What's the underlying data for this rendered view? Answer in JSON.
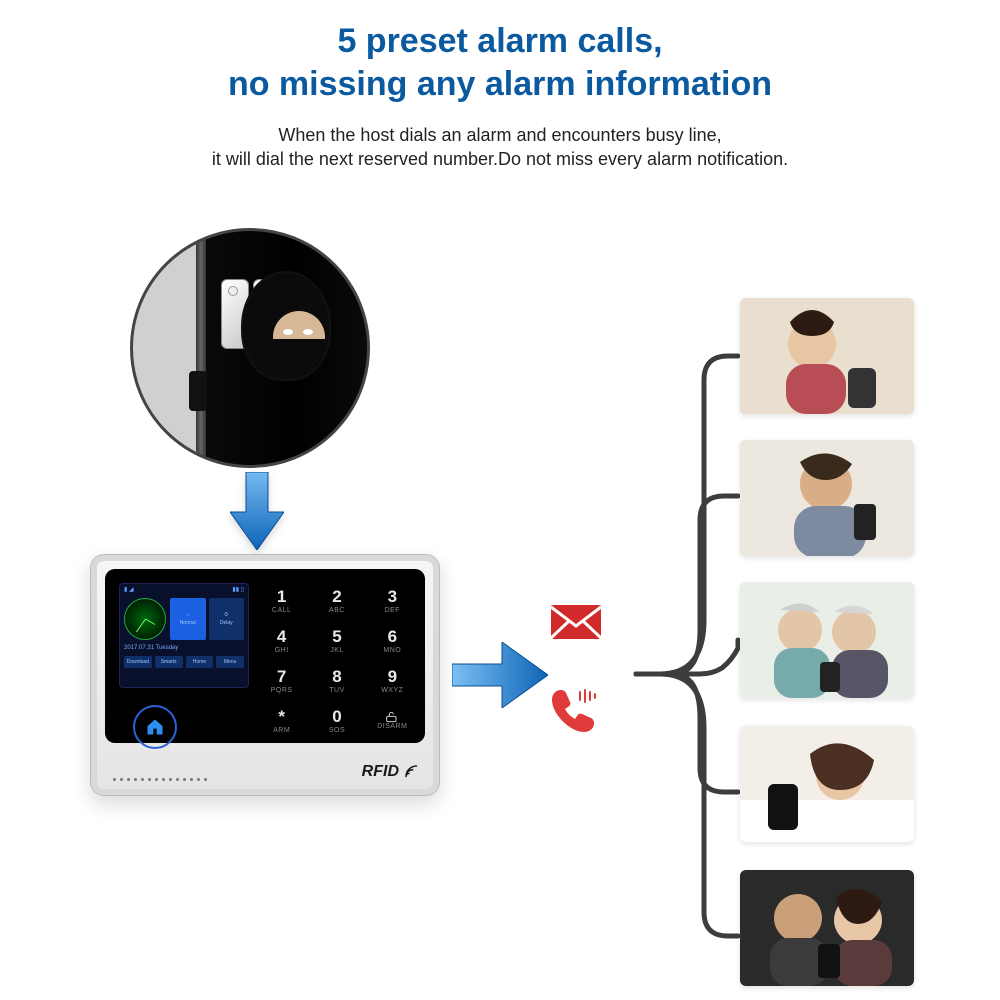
{
  "header": {
    "title_line1": "5 preset alarm calls,",
    "title_line2": "no missing any alarm information",
    "sub_line1": "When the host dials an alarm and encounters busy line,",
    "sub_line2": "it will dial the next reserved number.Do not miss every alarm notification."
  },
  "device": {
    "brand": "RFID",
    "lcd": {
      "date": "2017.07.31 Tuesday",
      "tiles": [
        "Normal",
        "Delay"
      ],
      "bottom": [
        "Download",
        "Smarts",
        "Home",
        "Menu"
      ]
    },
    "keypad": [
      {
        "n": "1",
        "s": "CALL"
      },
      {
        "n": "2",
        "s": "ABC"
      },
      {
        "n": "3",
        "s": "DEF"
      },
      {
        "n": "4",
        "s": "GHI"
      },
      {
        "n": "5",
        "s": "JKL"
      },
      {
        "n": "6",
        "s": "MNO"
      },
      {
        "n": "7",
        "s": "PQRS"
      },
      {
        "n": "8",
        "s": "TUV"
      },
      {
        "n": "9",
        "s": "WXYZ"
      },
      {
        "n": "*",
        "s": "ARM"
      },
      {
        "n": "0",
        "s": "SOS"
      },
      {
        "n": "#",
        "s": "DISARM"
      }
    ]
  },
  "icons": {
    "mail": "mail-icon",
    "phone": "phone-icon",
    "home": "home-icon",
    "rfid_waves": "rfid-waves-icon"
  },
  "colors": {
    "title": "#0b5aa0",
    "arrow_blue": "#1f7fd6",
    "mail_red": "#d12a2a",
    "phone_red": "#e13a3a",
    "wire": "#3d3d3d"
  },
  "contacts": [
    {
      "label": "contact-1"
    },
    {
      "label": "contact-2"
    },
    {
      "label": "contact-3"
    },
    {
      "label": "contact-4"
    },
    {
      "label": "contact-5"
    }
  ]
}
